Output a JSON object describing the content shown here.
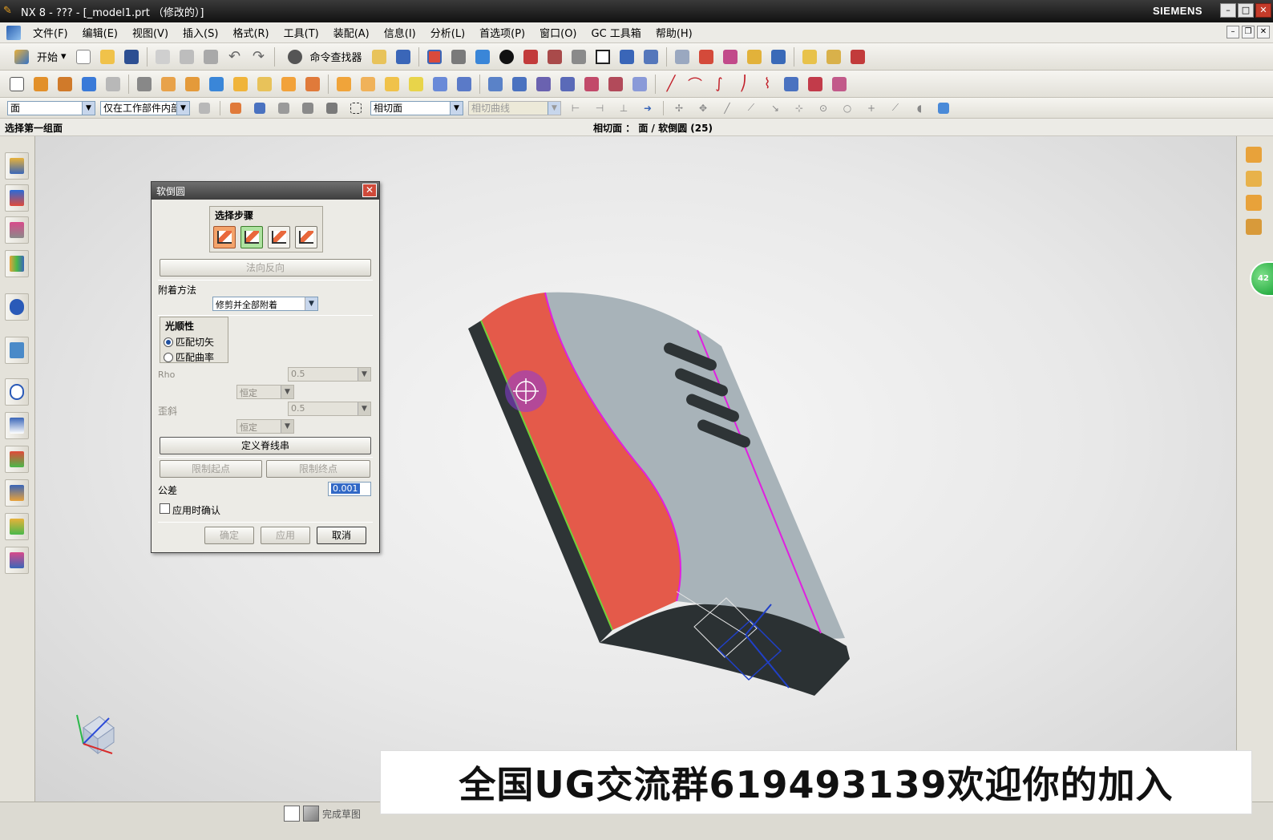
{
  "window": {
    "title": "NX 8 - ??? - [_model1.prt （修改的）]",
    "brand": "SIEMENS",
    "buttons": [
      "minimize",
      "maximize",
      "close"
    ]
  },
  "menu": {
    "items": [
      "文件(F)",
      "编辑(E)",
      "视图(V)",
      "插入(S)",
      "格式(R)",
      "工具(T)",
      "装配(A)",
      "信息(I)",
      "分析(L)",
      "首选项(P)",
      "窗口(O)",
      "GC 工具箱",
      "帮助(H)"
    ]
  },
  "toolbar": {
    "start_label": "开始",
    "command_finder_label": "命令查找器",
    "selection_filter": "面",
    "selection_scope": "仅在工作部件内部",
    "face_rule": "相切面",
    "curve_rule": "相切曲线"
  },
  "status": {
    "prompt": "选择第一组面",
    "info": "相切面 ： 面 / 软倒圆 (25)"
  },
  "dialog": {
    "title": "软倒圆",
    "step_group_title": "选择步骤",
    "reverse_normal_label": "法向反向",
    "attach_method_label": "附着方法",
    "attach_method_value": "修剪并全部附着",
    "smoothness_title": "光顺性",
    "smoothness_options": [
      {
        "label": "匹配切矢",
        "selected": true
      },
      {
        "label": "匹配曲率",
        "selected": false
      }
    ],
    "rho_label": "Rho",
    "rho_value": "0.5",
    "rho_law": "恒定",
    "skew_label": "歪斜",
    "skew_value": "0.5",
    "skew_law": "恒定",
    "define_spine_label": "定义脊线串",
    "limit_start_label": "限制起点",
    "limit_end_label": "限制终点",
    "tolerance_label": "公差",
    "tolerance_value": "0.001",
    "confirm_on_apply_label": "应用时确认",
    "ok_label": "确定",
    "apply_label": "应用",
    "cancel_label": "取消"
  },
  "cue": {
    "finish_sketch_label": "完成草图"
  },
  "banner": {
    "text": "全国UG交流群619493139欢迎你的加入"
  },
  "right_orb_label": "42",
  "colors": {
    "fillet_face": "#e45a4a",
    "body_face": "#a7b2b8",
    "dark_face": "#2e3436",
    "edge_magenta": "#e01fe0",
    "edge_green": "#6fd23a"
  }
}
